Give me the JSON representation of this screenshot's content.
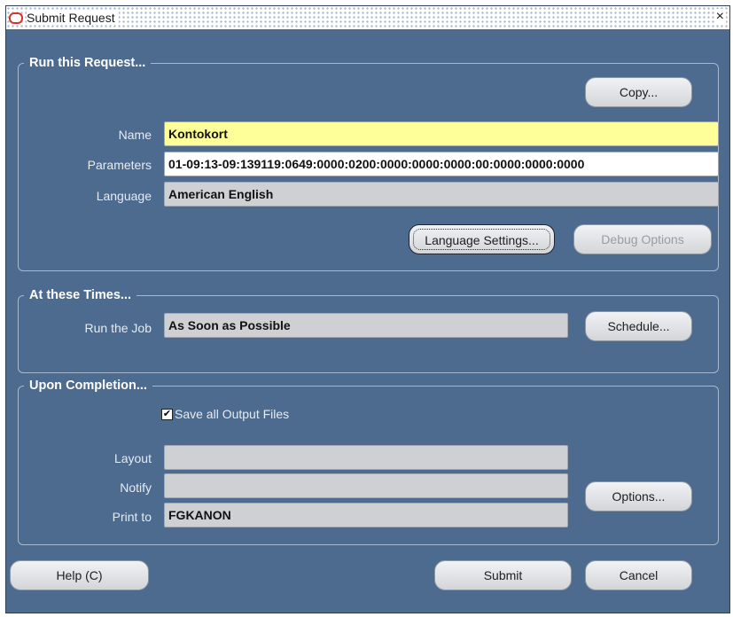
{
  "window": {
    "title": "Submit Request",
    "close": "×"
  },
  "run_request": {
    "legend": "Run this Request...",
    "copy_label": "Copy...",
    "name_label": "Name",
    "name_value": "Kontokort",
    "parameters_label": "Parameters",
    "parameters_value": "01-09:13-09:139119:0649:0000:0200:0000:0000:0000:00:0000:0000:0000",
    "language_label": "Language",
    "language_value": "American English",
    "language_settings_label": "Language Settings...",
    "debug_options_label": "Debug Options"
  },
  "times": {
    "legend": "At these Times...",
    "run_job_label": "Run the Job",
    "run_job_value": "As Soon as Possible",
    "schedule_label": "Schedule..."
  },
  "completion": {
    "legend": "Upon Completion...",
    "save_output_label": "Save all Output Files",
    "save_output_checked": true,
    "layout_label": "Layout",
    "layout_value": "",
    "notify_label": "Notify",
    "notify_value": "",
    "print_to_label": "Print to",
    "print_to_value": "FGKANON",
    "options_label": "Options..."
  },
  "footer": {
    "help_label": "Help (C)",
    "submit_label": "Submit",
    "cancel_label": "Cancel"
  },
  "colors": {
    "window_bg": "#4d6a8f",
    "required_field": "#ffff99",
    "readonly_field": "#cfd0d3"
  },
  "icons": {
    "title_icon": "oracle-icon",
    "close_icon": "close-icon"
  }
}
